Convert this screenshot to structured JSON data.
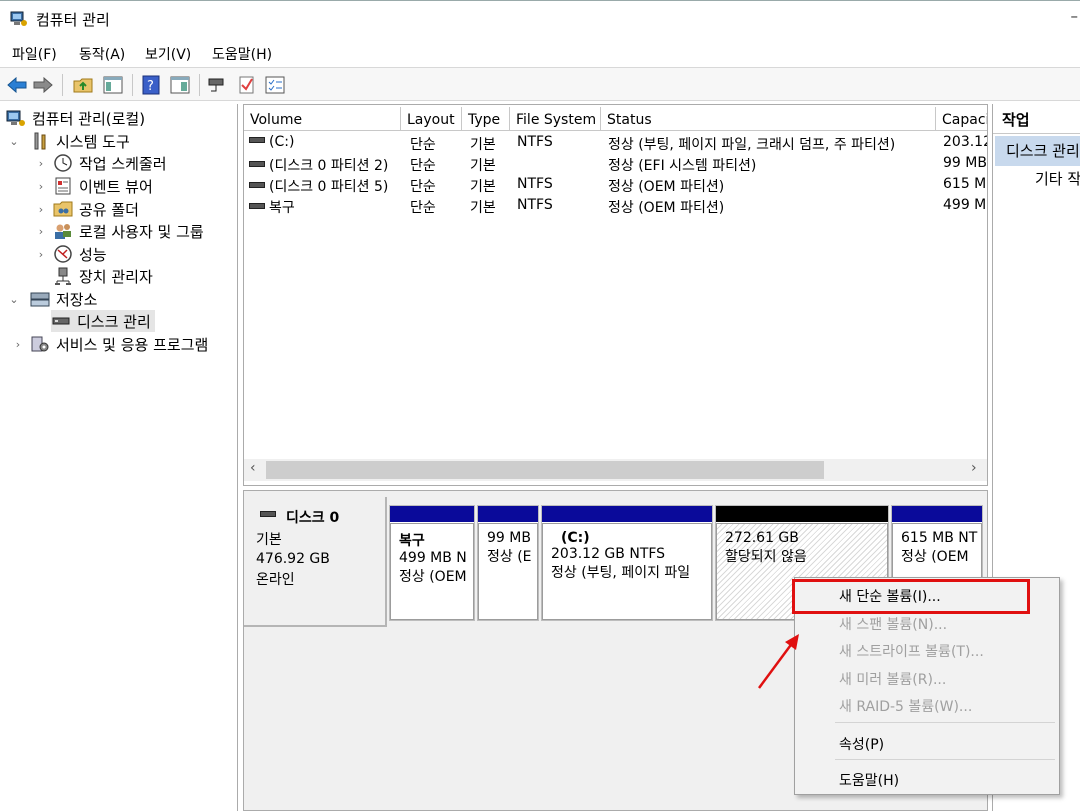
{
  "window": {
    "title": "컴퓨터 관리",
    "minimize_glyph": "–"
  },
  "menu": [
    "파일(F)",
    "동작(A)",
    "보기(V)",
    "도움말(H)"
  ],
  "toolbar_icons": [
    "back-arrow-icon",
    "forward-arrow-icon",
    "folder-up-icon",
    "show-tree-icon",
    "help-icon",
    "show-action-pane-icon",
    "connect-icon",
    "check-icon",
    "properties-icon"
  ],
  "tree": {
    "root": "컴퓨터 관리(로컬)",
    "system_tools": "시스템 도구",
    "task_scheduler": "작업 스케줄러",
    "event_viewer": "이벤트 뷰어",
    "shared_folders": "공유 폴더",
    "local_users": "로컬 사용자 및 그룹",
    "performance": "성능",
    "device_manager": "장치 관리자",
    "storage": "저장소",
    "disk_management": "디스크 관리",
    "services": "서비스 및 응용 프로그램"
  },
  "volume_list": {
    "columns": [
      "Volume",
      "Layout",
      "Type",
      "File System",
      "Status",
      "Capaci"
    ],
    "rows": [
      {
        "volume": "(C:)",
        "layout": "단순",
        "type": "기본",
        "fs": "NTFS",
        "status": "정상 (부팅, 페이지 파일, 크래시 덤프, 주 파티션)",
        "capacity": "203.12"
      },
      {
        "volume": "(디스크 0 파티션 2)",
        "layout": "단순",
        "type": "기본",
        "fs": "",
        "status": "정상 (EFI 시스템 파티션)",
        "capacity": "99 MB"
      },
      {
        "volume": "(디스크 0 파티션 5)",
        "layout": "단순",
        "type": "기본",
        "fs": "NTFS",
        "status": "정상 (OEM 파티션)",
        "capacity": "615 M"
      },
      {
        "volume": "복구",
        "layout": "단순",
        "type": "기본",
        "fs": "NTFS",
        "status": "정상 (OEM 파티션)",
        "capacity": "499 M"
      }
    ],
    "scroll_left": "‹",
    "scroll_right": "›"
  },
  "disk": {
    "name": "디스크 0",
    "type": "기본",
    "size": "476.92 GB",
    "state": "온라인",
    "partitions": [
      {
        "name": "복구",
        "line1": "499 MB N",
        "line2": "정상 (OEM"
      },
      {
        "name": "",
        "line1": "99 MB",
        "line2": "정상 (E"
      },
      {
        "name": "(C:)",
        "line1": "203.12 GB NTFS",
        "line2": "정상 (부팅, 페이지 파일"
      },
      {
        "name": "",
        "line1": "272.61 GB",
        "line2": "할당되지 않음"
      },
      {
        "name": "",
        "line1": "615 MB NT",
        "line2": "정상 (OEM"
      }
    ]
  },
  "actions_pane": {
    "header": "작업",
    "selected": "디스크 관리",
    "more": "기타 작"
  },
  "context_menu": {
    "items": [
      {
        "label": "새 단순 볼륨(I)...",
        "enabled": true
      },
      {
        "label": "새 스팬 볼륨(N)...",
        "enabled": false
      },
      {
        "label": "새 스트라이프 볼륨(T)...",
        "enabled": false
      },
      {
        "label": "새 미러 볼륨(R)...",
        "enabled": false
      },
      {
        "label": "새 RAID-5 볼륨(W)...",
        "enabled": false
      },
      {
        "label": "속성(P)",
        "enabled": true
      },
      {
        "label": "도움말(H)",
        "enabled": true
      }
    ]
  },
  "colors": {
    "partition_bar": "#0a0a9a",
    "unallocated_bar": "#000000",
    "highlight": "#e01010",
    "selection": "#c8d9ed"
  }
}
